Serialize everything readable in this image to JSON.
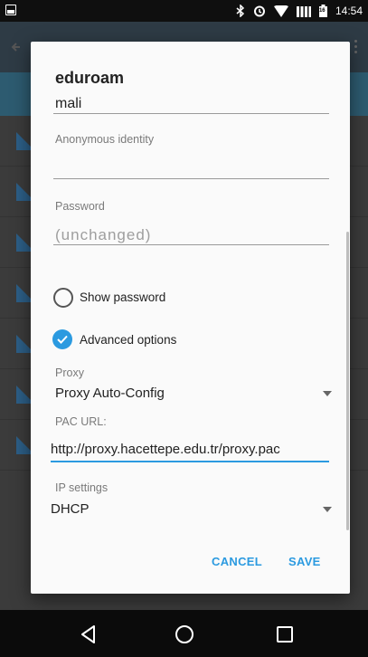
{
  "status_bar": {
    "time": "14:54",
    "icons": [
      "screenshot-icon",
      "bluetooth-icon",
      "alarm-icon",
      "wifi-icon",
      "signal-icon",
      "battery-icon"
    ],
    "battery_level": "16"
  },
  "dialog": {
    "title": "eduroam",
    "identity_value": "mali",
    "anonymous_identity_label": "Anonymous identity",
    "anonymous_identity_value": "",
    "password_label": "Password",
    "password_placeholder": "(unchanged)",
    "show_password_label": "Show password",
    "show_password_checked": false,
    "advanced_options_label": "Advanced options",
    "advanced_options_checked": true,
    "proxy_label": "Proxy",
    "proxy_value": "Proxy Auto-Config",
    "pac_url_label": "PAC URL:",
    "pac_url_value": "http://proxy.hacettepe.edu.tr/proxy.pac",
    "ip_settings_label": "IP settings",
    "ip_settings_value": "DHCP",
    "cancel_label": "CANCEL",
    "save_label": "SAVE"
  },
  "nav_bar": {
    "icons": [
      "back-icon",
      "home-icon",
      "recents-icon"
    ]
  },
  "colors": {
    "accent": "#2b9ae0",
    "dialog_bg": "#fafafa",
    "status_bar": "#0f0f0f",
    "nav_bar": "#0b0b0b"
  }
}
